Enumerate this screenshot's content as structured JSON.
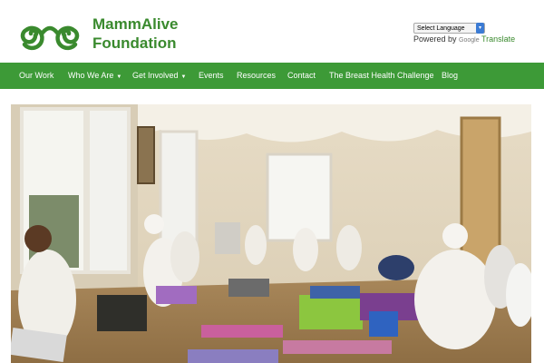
{
  "brand": {
    "line1": "MammAlive",
    "line2": "Foundation",
    "color": "#3a8a2e"
  },
  "translate": {
    "select_label": "Select Language",
    "powered_by": "Powered by",
    "google": "Google",
    "translate": "Translate"
  },
  "nav": {
    "color": "#3d9a37",
    "items": [
      {
        "label": "Our Work"
      },
      {
        "label": "Who We Are"
      },
      {
        "label": "Get Involved"
      },
      {
        "label": "Events"
      },
      {
        "label": "Resources"
      },
      {
        "label": "Contact"
      },
      {
        "label": "The Breast Health Challenge"
      },
      {
        "label": "Blog"
      }
    ]
  },
  "icons": {
    "logo": "spiral-logo-icon",
    "dropdown": "chevron-down-icon"
  }
}
